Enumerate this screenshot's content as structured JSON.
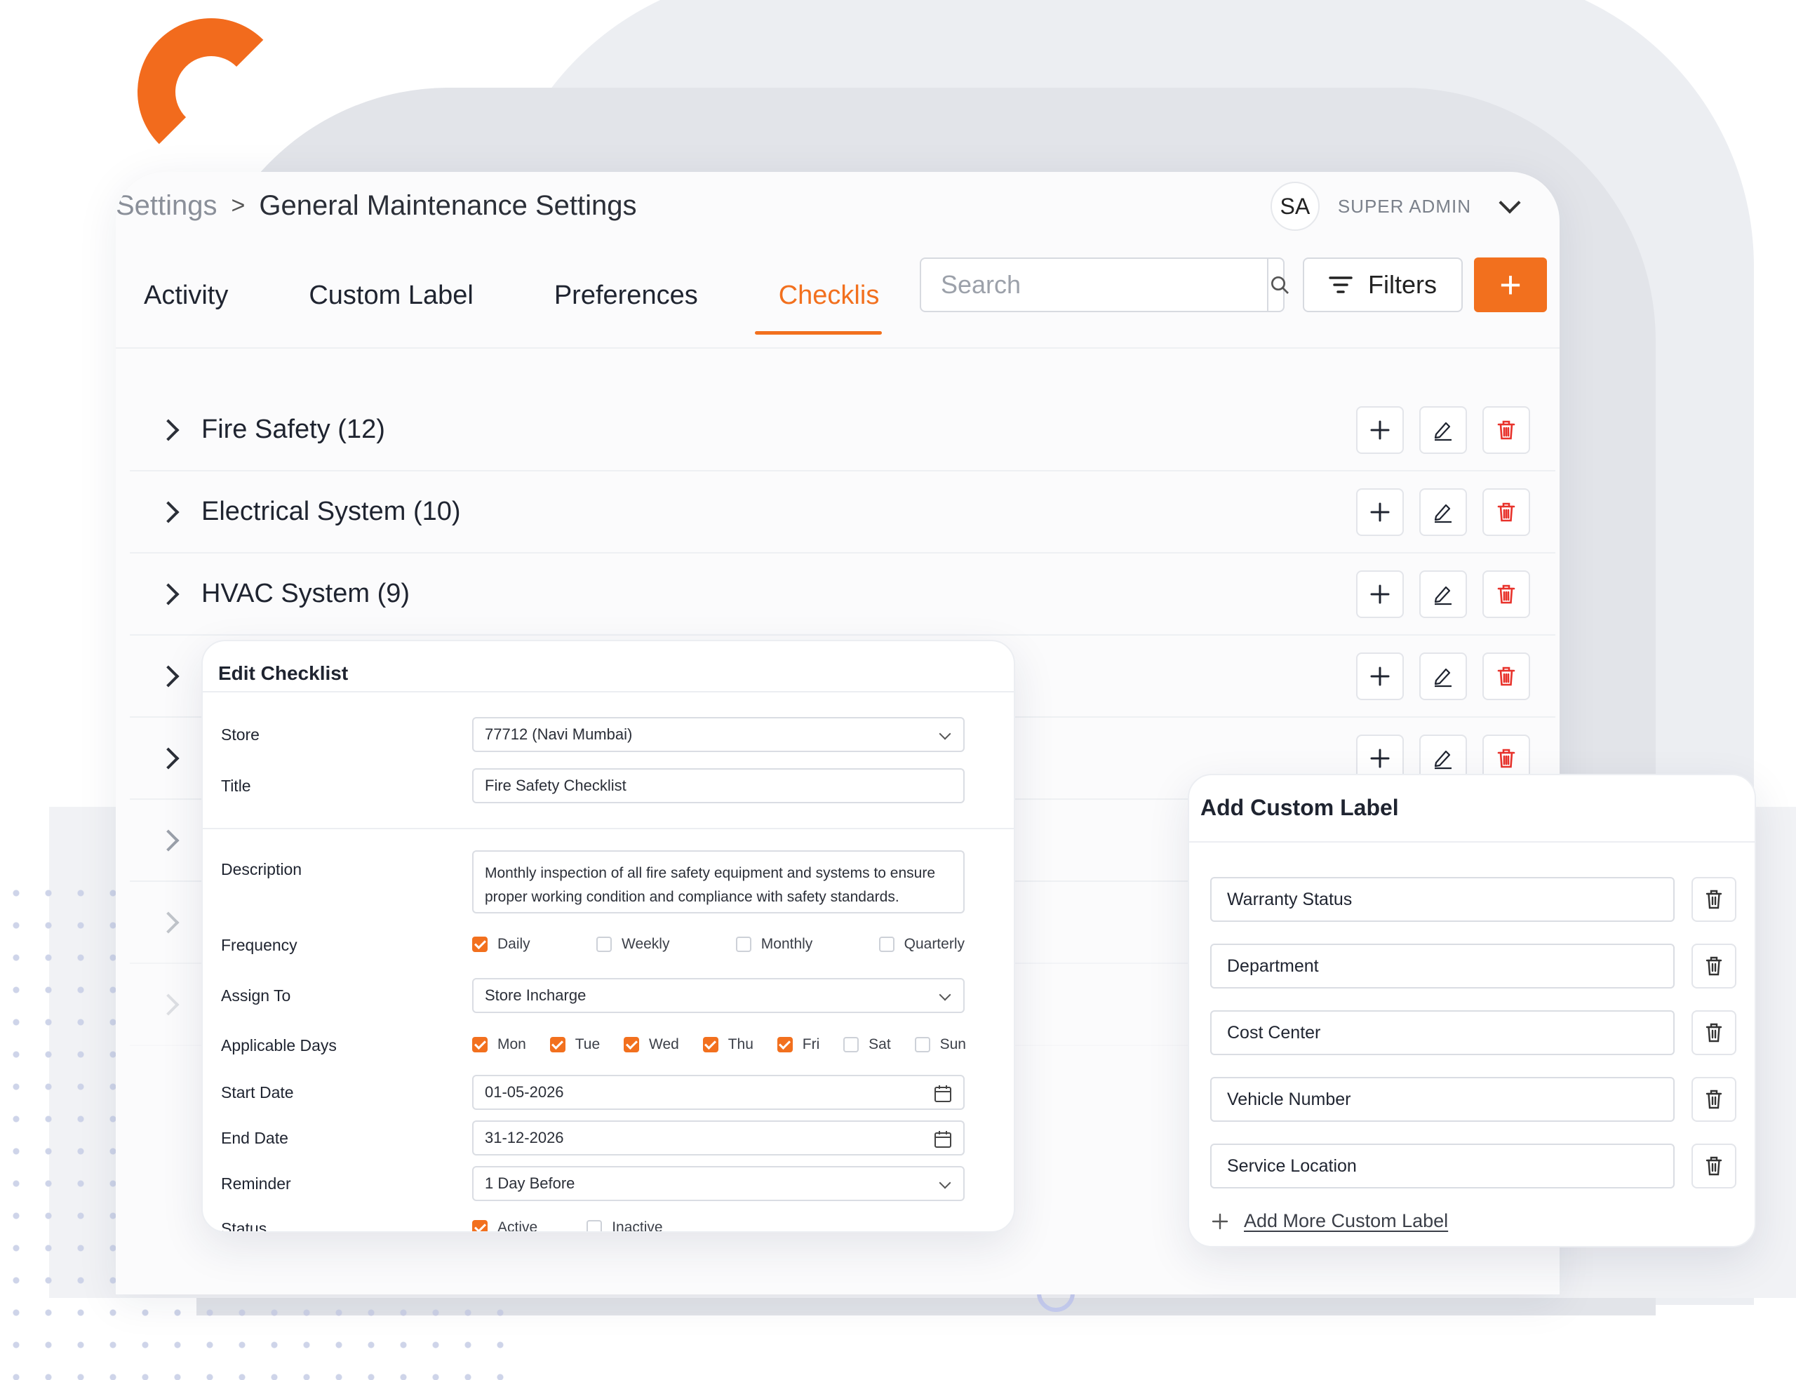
{
  "breadcrumb": {
    "parent": "Settings",
    "separator": ">",
    "current": "General Maintenance Settings"
  },
  "user": {
    "initials": "SA",
    "name": "SUPER ADMIN"
  },
  "tabs": [
    {
      "label": "Activity"
    },
    {
      "label": "Custom Label"
    },
    {
      "label": "Preferences"
    },
    {
      "label": "Checklis"
    }
  ],
  "search": {
    "placeholder": "Search",
    "value": ""
  },
  "filters_label": "Filters",
  "add_label": "+",
  "checklist_groups": [
    {
      "title": "Fire Safety (12)"
    },
    {
      "title": "Electrical System (10)"
    },
    {
      "title": "HVAC System (9)"
    },
    {
      "title": ""
    },
    {
      "title": ""
    }
  ],
  "edit_checklist": {
    "title": "Edit Checklist",
    "fields": {
      "store": {
        "label": "Store",
        "value": "77712 (Navi Mumbai)"
      },
      "title": {
        "label": "Title",
        "value": "Fire Safety Checklist"
      },
      "description": {
        "label": "Description",
        "line1": "Monthly inspection of all fire safety equipment and systems to ensure",
        "line2": "proper working condition and compliance with safety standards."
      },
      "frequency": {
        "label": "Frequency",
        "options": [
          {
            "label": "Daily",
            "checked": true
          },
          {
            "label": "Weekly",
            "checked": false
          },
          {
            "label": "Monthly",
            "checked": false
          },
          {
            "label": "Quarterly",
            "checked": false
          }
        ]
      },
      "assign_to": {
        "label": "Assign To",
        "value": "Store Incharge"
      },
      "applicable_days": {
        "label": "Applicable Days",
        "options": [
          {
            "label": "Mon",
            "checked": true
          },
          {
            "label": "Tue",
            "checked": true
          },
          {
            "label": "Wed",
            "checked": true
          },
          {
            "label": "Thu",
            "checked": true
          },
          {
            "label": "Fri",
            "checked": true
          },
          {
            "label": "Sat",
            "checked": false
          },
          {
            "label": "Sun",
            "checked": false
          }
        ]
      },
      "start_date": {
        "label": "Start Date",
        "value": "01-05-2026"
      },
      "end_date": {
        "label": "End Date",
        "value": "31-12-2026"
      },
      "reminder": {
        "label": "Reminder",
        "value": "1 Day Before"
      },
      "status": {
        "label": "Status",
        "options": [
          {
            "label": "Active",
            "checked": true
          },
          {
            "label": "Inactive",
            "checked": false
          }
        ]
      }
    }
  },
  "custom_label": {
    "title": "Add Custom Label",
    "labels": [
      "Warranty Status",
      "Department",
      "Cost Center",
      "Vehicle Number",
      "Service Location"
    ],
    "add_more": "Add More Custom Label"
  },
  "colors": {
    "accent": "#f2701e",
    "danger": "#e8322b",
    "text": "#1f2430",
    "muted": "#8a8f99"
  }
}
